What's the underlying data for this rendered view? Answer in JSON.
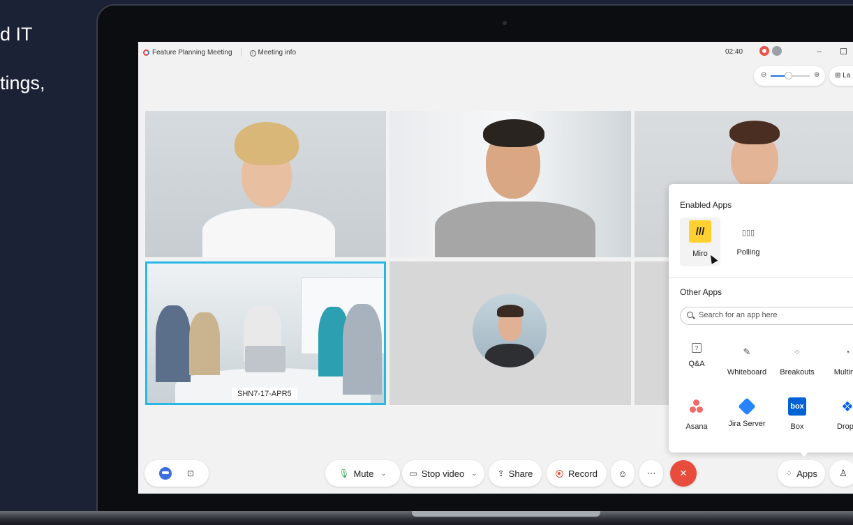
{
  "side_text": {
    "line1": "d IT",
    "line2": "tings,"
  },
  "window": {
    "meeting_title": "Feature Planning Meeting",
    "meeting_info_label": "Meeting info",
    "timer": "02:40",
    "layout_label": "La"
  },
  "tiles": {
    "room_name": "SHN7-17-APR5"
  },
  "apps_panel": {
    "enabled_heading": "Enabled Apps",
    "enabled": [
      {
        "label": "Miro",
        "icon": "miro-icon"
      },
      {
        "label": "Polling",
        "icon": "polling-icon"
      }
    ],
    "other_heading": "Other Apps",
    "search_placeholder": "Search for an app here",
    "other": [
      {
        "label": "Q&A",
        "icon": "qa-icon"
      },
      {
        "label": "Whiteboard",
        "icon": "whiteboard-icon"
      },
      {
        "label": "Breakouts",
        "icon": "breakouts-icon"
      },
      {
        "label": "Multime",
        "icon": "multimedia-icon"
      },
      {
        "label": "Asana",
        "icon": "asana-icon"
      },
      {
        "label": "Jira Server",
        "icon": "jira-icon"
      },
      {
        "label": "Box",
        "icon": "box-icon"
      },
      {
        "label": "Dropb",
        "icon": "dropbox-icon"
      }
    ]
  },
  "controls": {
    "mute": "Mute",
    "stop_video": "Stop video",
    "share": "Share",
    "record": "Record",
    "apps": "Apps"
  },
  "colors": {
    "background": "#1c2236",
    "leave": "#e84c3d",
    "accent_blue": "#1f6fe5",
    "selected_tile_border": "#29b7e5",
    "miro": "#ffd02f",
    "mic": "#2ca94f"
  }
}
